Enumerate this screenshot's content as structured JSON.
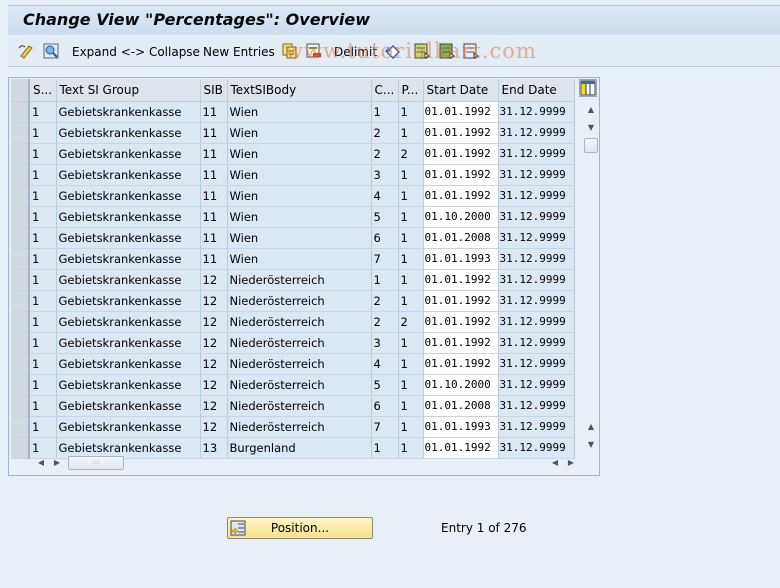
{
  "title": "Change View \"Percentages\": Overview",
  "toolbar": {
    "expand_collapse": "Expand <-> Collapse",
    "new_entries": "New Entries",
    "delimit": "Delimit",
    "icons": [
      "edit-display-icon",
      "details-icon",
      "copy-icon",
      "delete-icon",
      "undo-icon",
      "select-all-icon",
      "select-block-icon",
      "deselect-all-icon"
    ]
  },
  "watermark": "www.tutorialkart.com",
  "table": {
    "columns": [
      "S...",
      "Text SI Group",
      "SIB",
      "TextSIBody",
      "C...",
      "P...",
      "Start Date",
      "End Date"
    ],
    "rows": [
      [
        "1",
        "Gebietskrankenkasse",
        "11",
        "Wien",
        "1",
        "1",
        "01.01.1992",
        "31.12.9999"
      ],
      [
        "1",
        "Gebietskrankenkasse",
        "11",
        "Wien",
        "2",
        "1",
        "01.01.1992",
        "31.12.9999"
      ],
      [
        "1",
        "Gebietskrankenkasse",
        "11",
        "Wien",
        "2",
        "2",
        "01.01.1992",
        "31.12.9999"
      ],
      [
        "1",
        "Gebietskrankenkasse",
        "11",
        "Wien",
        "3",
        "1",
        "01.01.1992",
        "31.12.9999"
      ],
      [
        "1",
        "Gebietskrankenkasse",
        "11",
        "Wien",
        "4",
        "1",
        "01.01.1992",
        "31.12.9999"
      ],
      [
        "1",
        "Gebietskrankenkasse",
        "11",
        "Wien",
        "5",
        "1",
        "01.10.2000",
        "31.12.9999"
      ],
      [
        "1",
        "Gebietskrankenkasse",
        "11",
        "Wien",
        "6",
        "1",
        "01.01.2008",
        "31.12.9999"
      ],
      [
        "1",
        "Gebietskrankenkasse",
        "11",
        "Wien",
        "7",
        "1",
        "01.01.1993",
        "31.12.9999"
      ],
      [
        "1",
        "Gebietskrankenkasse",
        "12",
        "Niederösterreich",
        "1",
        "1",
        "01.01.1992",
        "31.12.9999"
      ],
      [
        "1",
        "Gebietskrankenkasse",
        "12",
        "Niederösterreich",
        "2",
        "1",
        "01.01.1992",
        "31.12.9999"
      ],
      [
        "1",
        "Gebietskrankenkasse",
        "12",
        "Niederösterreich",
        "2",
        "2",
        "01.01.1992",
        "31.12.9999"
      ],
      [
        "1",
        "Gebietskrankenkasse",
        "12",
        "Niederösterreich",
        "3",
        "1",
        "01.01.1992",
        "31.12.9999"
      ],
      [
        "1",
        "Gebietskrankenkasse",
        "12",
        "Niederösterreich",
        "4",
        "1",
        "01.01.1992",
        "31.12.9999"
      ],
      [
        "1",
        "Gebietskrankenkasse",
        "12",
        "Niederösterreich",
        "5",
        "1",
        "01.10.2000",
        "31.12.9999"
      ],
      [
        "1",
        "Gebietskrankenkasse",
        "12",
        "Niederösterreich",
        "6",
        "1",
        "01.01.2008",
        "31.12.9999"
      ],
      [
        "1",
        "Gebietskrankenkasse",
        "12",
        "Niederösterreich",
        "7",
        "1",
        "01.01.1993",
        "31.12.9999"
      ],
      [
        "1",
        "Gebietskrankenkasse",
        "13",
        "Burgenland",
        "1",
        "1",
        "01.01.1992",
        "31.12.9999"
      ]
    ]
  },
  "footer": {
    "position_label": "Position...",
    "entry_info": "Entry 1 of 276"
  }
}
